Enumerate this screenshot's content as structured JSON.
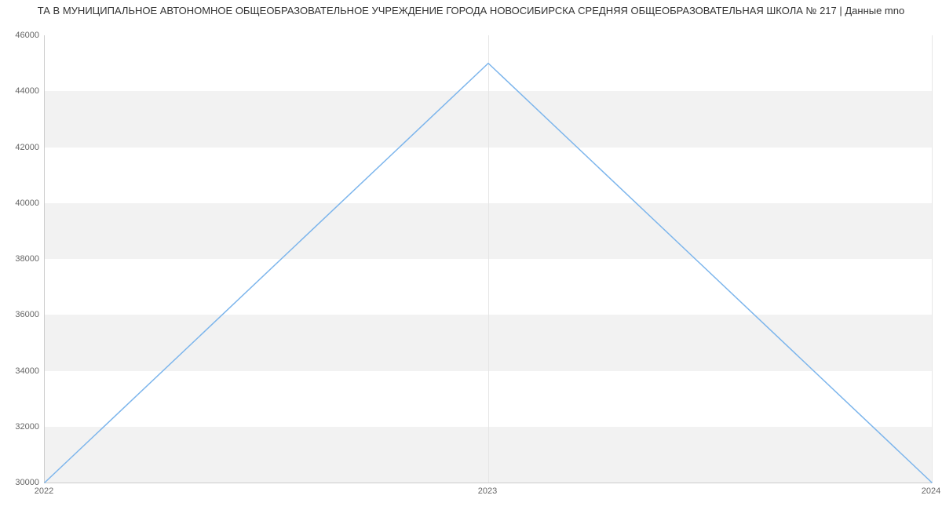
{
  "chart_data": {
    "type": "line",
    "title": "ТА В МУНИЦИПАЛЬНОЕ АВТОНОМНОЕ ОБЩЕОБРАЗОВАТЕЛЬНОЕ УЧРЕЖДЕНИЕ ГОРОДА НОВОСИБИРСКА СРЕДНЯЯ ОБЩЕОБРАЗОВАТЕЛЬНАЯ ШКОЛА № 217 | Данные mno",
    "xlabel": "",
    "ylabel": "",
    "categories": [
      "2022",
      "2023",
      "2024"
    ],
    "x": [
      2022,
      2023,
      2024
    ],
    "values": [
      30000,
      45000,
      30000
    ],
    "xlim": [
      2022,
      2024
    ],
    "ylim": [
      30000,
      46000
    ],
    "yticks": [
      30000,
      32000,
      34000,
      36000,
      38000,
      40000,
      42000,
      44000,
      46000
    ],
    "grid": {
      "x_gridlines": true,
      "y_bands_alt": true
    },
    "line_color": "#7cb5ec"
  }
}
